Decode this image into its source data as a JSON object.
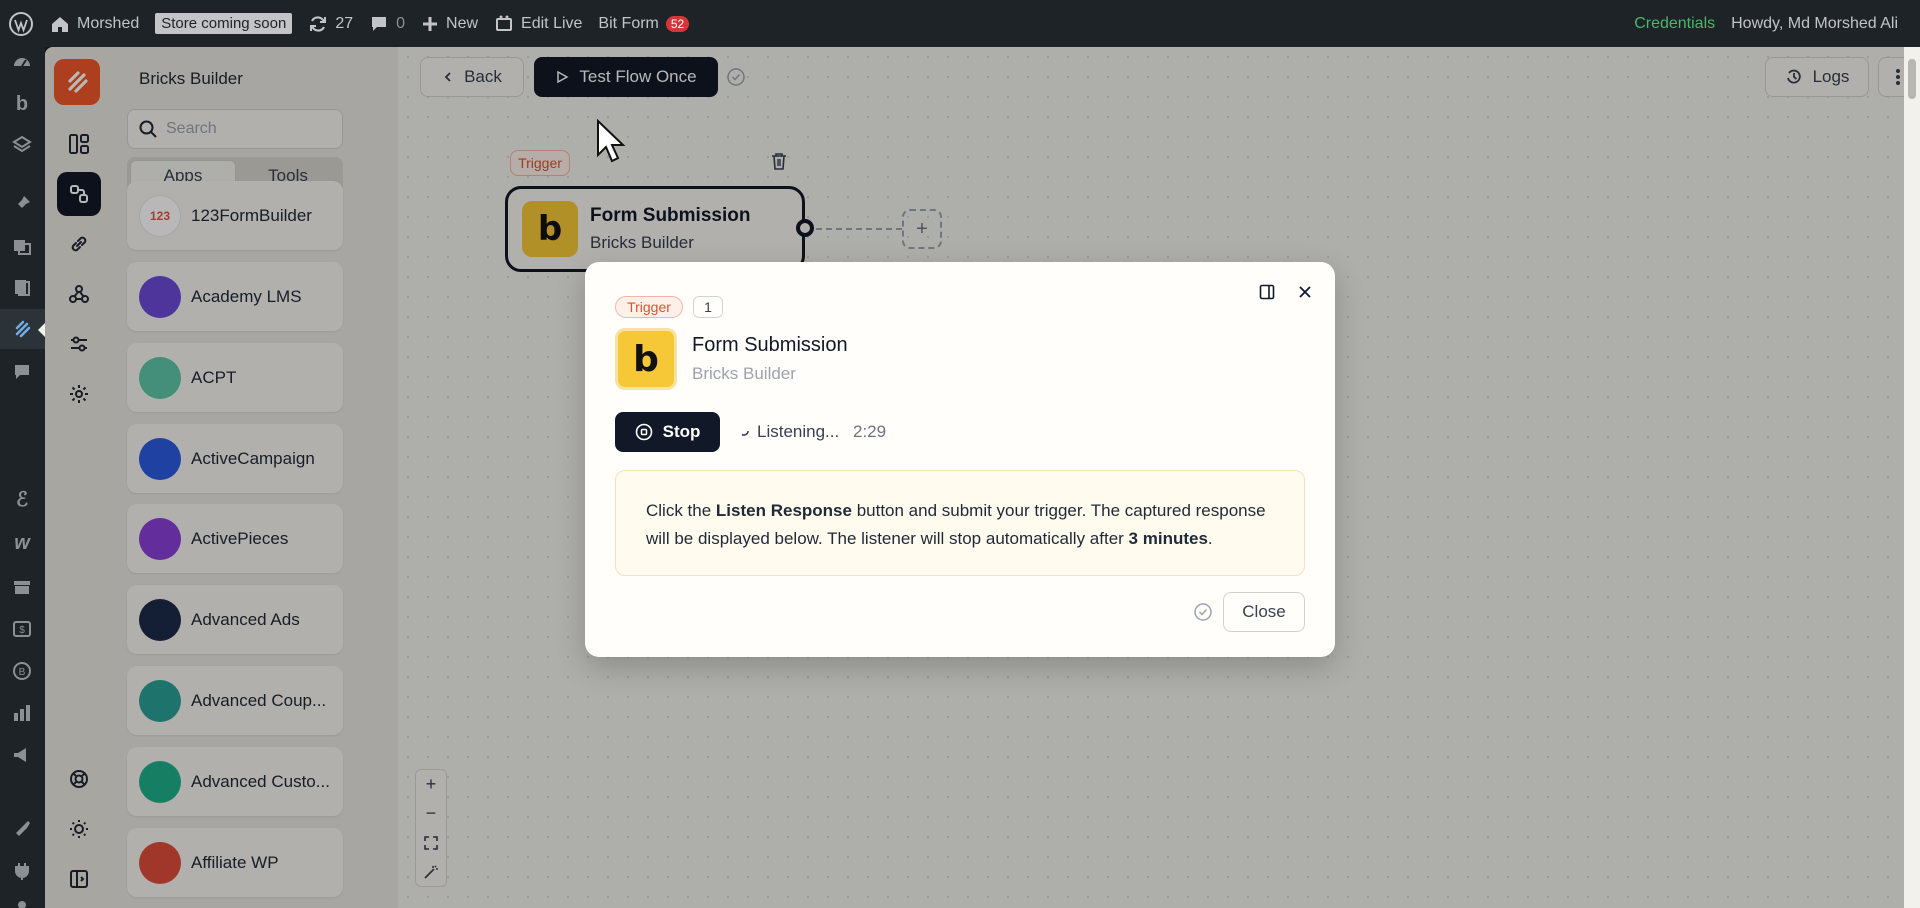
{
  "adminbar": {
    "site_name": "Morshed",
    "store_badge": "Store coming soon",
    "updates_count": "27",
    "comments_count": "0",
    "new_label": "New",
    "edit_live_label": "Edit Live",
    "bit_form_label": "Bit Form",
    "bit_form_count": "52",
    "credentials_label": "Credentials",
    "howdy_label": "Howdy, Md Morshed Ali"
  },
  "panel": {
    "title": "Bricks Builder",
    "search_placeholder": "Search",
    "tabs": [
      {
        "label": "Apps",
        "active": true
      },
      {
        "label": "Tools",
        "active": false
      }
    ],
    "apps": [
      {
        "label": "123FormBuilder",
        "icon": "123formbuilder-icon",
        "color": "#ffffff"
      },
      {
        "label": "Academy LMS",
        "icon": "academy-lms-icon",
        "color": "#6c4ad8"
      },
      {
        "label": "ACPT",
        "icon": "acpt-icon",
        "color": "#5fc7a8"
      },
      {
        "label": "ActiveCampaign",
        "icon": "activecampaign-icon",
        "color": "#2c5be0"
      },
      {
        "label": "ActivePieces",
        "icon": "activepieces-icon",
        "color": "#8b3fd9"
      },
      {
        "label": "Advanced Ads",
        "icon": "advanced-ads-icon",
        "color": "#1d2c4c"
      },
      {
        "label": "Advanced Coup...",
        "icon": "advanced-coupons-icon",
        "color": "#2aa198"
      },
      {
        "label": "Advanced Custo...",
        "icon": "acf-icon",
        "color": "#1fb08a"
      },
      {
        "label": "Affiliate WP",
        "icon": "affiliate-wp-icon",
        "color": "#e04d3b"
      }
    ]
  },
  "toolbar": {
    "back_label": "Back",
    "test_flow_label": "Test Flow Once",
    "logs_label": "Logs"
  },
  "node": {
    "trigger_tag": "Trigger",
    "title": "Form Submission",
    "subtitle": "Bricks Builder",
    "logo_letter": "b"
  },
  "modal": {
    "trigger_tag": "Trigger",
    "step_number": "1",
    "title": "Form Submission",
    "subtitle": "Bricks Builder",
    "logo_letter": "b",
    "stop_label": "Stop",
    "listening_label": "Listening...",
    "timer": "2:29",
    "info_prefix": "Click the ",
    "info_bold1": "Listen Response",
    "info_mid": " button and submit your trigger. The captured response will be displayed below. The listener will stop automatically after ",
    "info_bold2": "3 minutes",
    "info_suffix": ".",
    "close_label": "Close"
  },
  "colors": {
    "accent": "#f0572a",
    "dark": "#111827",
    "bricks_yellow": "#f6c838",
    "credentials": "#4ab866"
  }
}
